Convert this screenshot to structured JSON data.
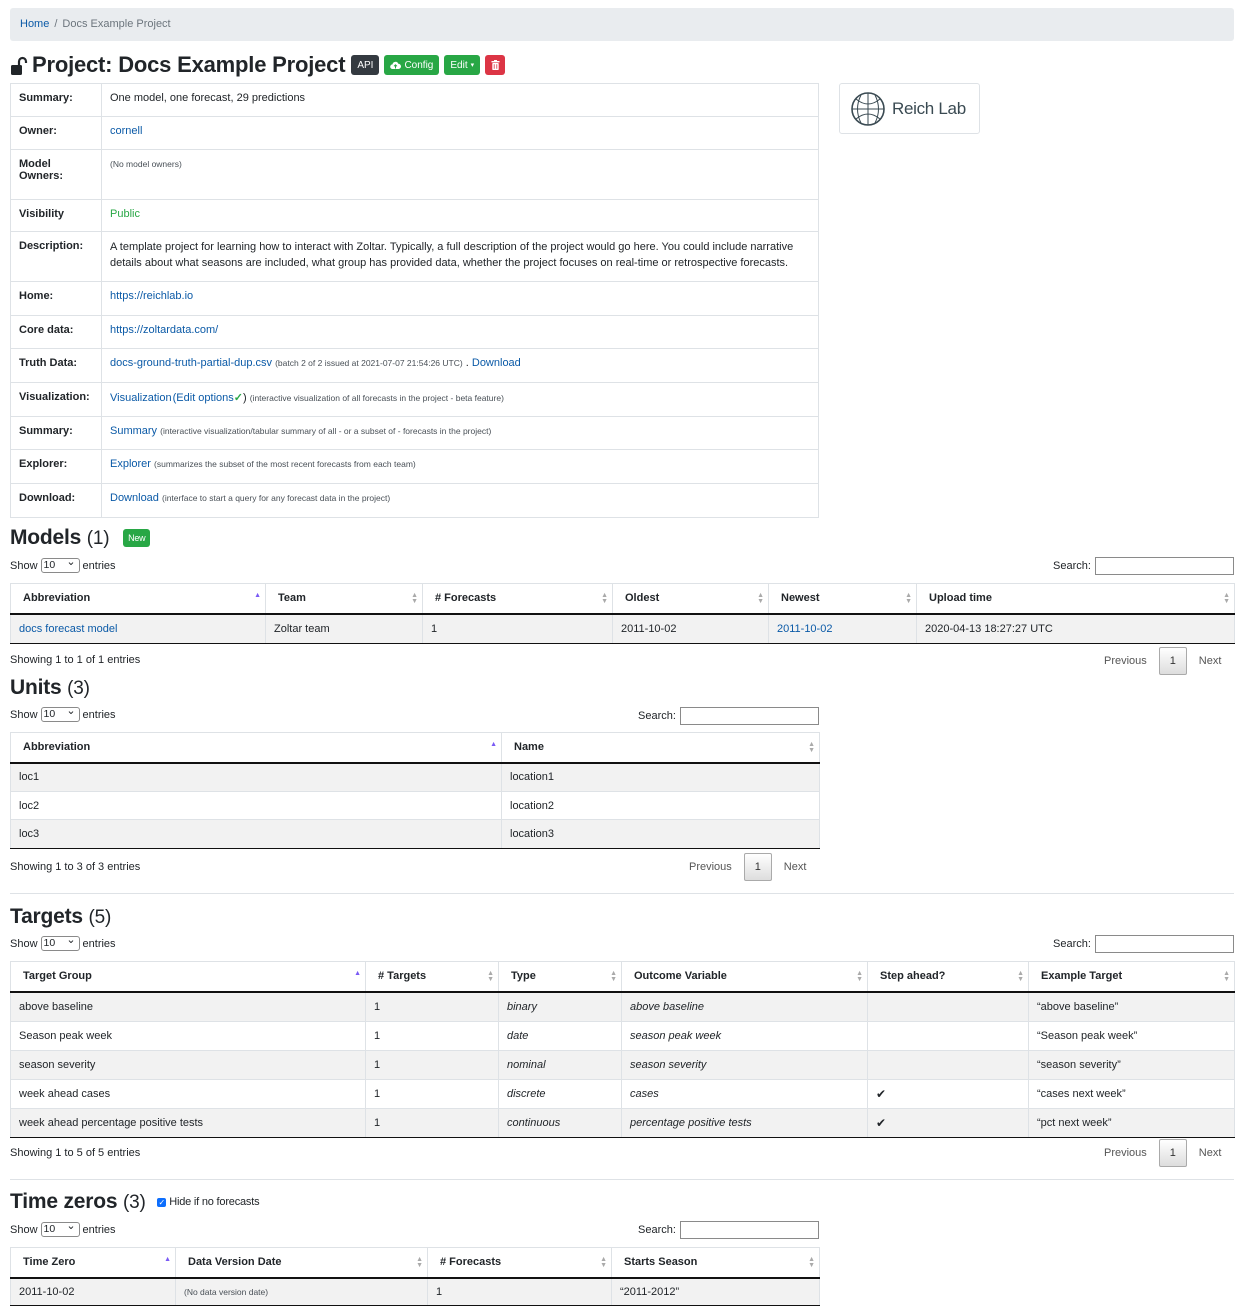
{
  "breadcrumb": {
    "home": "Home",
    "separator": "/",
    "current": "Docs Example Project"
  },
  "header": {
    "title": "Project: Docs Example Project",
    "api_label": "API",
    "config_label": "Config",
    "edit_label": "Edit",
    "icons": {
      "lock": "unlock-icon",
      "config": "cloud-icon",
      "delete": "trash-icon"
    }
  },
  "info": {
    "summary_label": "Summary:",
    "summary_value": "One model, one forecast, 29 predictions",
    "owner_label": "Owner:",
    "owner_value": "cornell",
    "model_owners_label": "Model Owners:",
    "model_owners_value": "(No model owners)",
    "visibility_label": "Visibility",
    "visibility_value": "Public",
    "description_label": "Description:",
    "description_value": "A template project for learning how to interact with Zoltar. Typically, a full description of the project would go here. You could include narrative details about what seasons are included, what group has provided data, whether the project focuses on real-time or retrospective forecasts.",
    "home_label": "Home:",
    "home_value": "https://reichlab.io",
    "core_label": "Core data:",
    "core_value": "https://zoltardata.com/",
    "truth_label": "Truth Data:",
    "truth_file": "docs-ground-truth-partial-dup.csv",
    "truth_note": "(batch 2 of 2 issued at 2021-07-07 21:54:26 UTC)",
    "truth_sep": ".",
    "truth_download": "Download",
    "viz_label": "Visualization:",
    "viz_link": "Visualization",
    "viz_open": "(",
    "viz_edit": "Edit options",
    "viz_close": ")",
    "viz_note": "(interactive visualization of all forecasts in the project - beta feature)",
    "summary2_label": "Summary:",
    "summary2_link": "Summary",
    "summary2_note": "(interactive visualization/tabular summary of all - or a subset of - forecasts in the project)",
    "explorer_label": "Explorer:",
    "explorer_link": "Explorer",
    "explorer_note": "(summarizes the subset of the most recent forecasts from each team)",
    "download_label": "Download:",
    "download_link": "Download",
    "download_note": "(interface to start a query for any forecast data in the project)"
  },
  "logo": {
    "text": "Reich Lab"
  },
  "common": {
    "show": "Show",
    "entries": "entries",
    "page_size": "10",
    "search": "Search:",
    "previous": "Previous",
    "next": "Next",
    "page": "1"
  },
  "models": {
    "title": "Models",
    "count": "(1)",
    "new_label": "New",
    "columns": [
      "Abbreviation",
      "Team",
      "# Forecasts",
      "Oldest",
      "Newest",
      "Upload time"
    ],
    "rows": [
      [
        "docs forecast model",
        "Zoltar team",
        "1",
        "2011-10-02",
        "2011-10-02",
        "2020-04-13 18:27:27 UTC"
      ]
    ],
    "showing": "Showing 1 to 1 of 1 entries"
  },
  "units": {
    "title": "Units",
    "count": "(3)",
    "columns": [
      "Abbreviation",
      "Name"
    ],
    "rows": [
      [
        "loc1",
        "location1"
      ],
      [
        "loc2",
        "location2"
      ],
      [
        "loc3",
        "location3"
      ]
    ],
    "showing": "Showing 1 to 3 of 3 entries"
  },
  "targets": {
    "title": "Targets",
    "count": "(5)",
    "columns": [
      "Target Group",
      "# Targets",
      "Type",
      "Outcome Variable",
      "Step ahead?",
      "Example Target"
    ],
    "rows": [
      [
        "above baseline",
        "1",
        "binary",
        "above baseline",
        "",
        "“above baseline”"
      ],
      [
        "Season peak week",
        "1",
        "date",
        "season peak week",
        "",
        "“Season peak week”"
      ],
      [
        "season severity",
        "1",
        "nominal",
        "season severity",
        "",
        "“season severity”"
      ],
      [
        "week ahead cases",
        "1",
        "discrete",
        "cases",
        "✔",
        "“cases next week”"
      ],
      [
        "week ahead percentage positive tests",
        "1",
        "continuous",
        "percentage positive tests",
        "✔",
        "“pct next week”"
      ]
    ],
    "showing": "Showing 1 to 5 of 5 entries"
  },
  "timezeros": {
    "title": "Time zeros",
    "count": "(3)",
    "hide_label": "Hide if no forecasts",
    "columns": [
      "Time Zero",
      "Data Version Date",
      "# Forecasts",
      "Starts Season"
    ],
    "rows": [
      [
        "2011-10-02",
        "(No data version date)",
        "1",
        "“2011-2012”"
      ]
    ]
  }
}
